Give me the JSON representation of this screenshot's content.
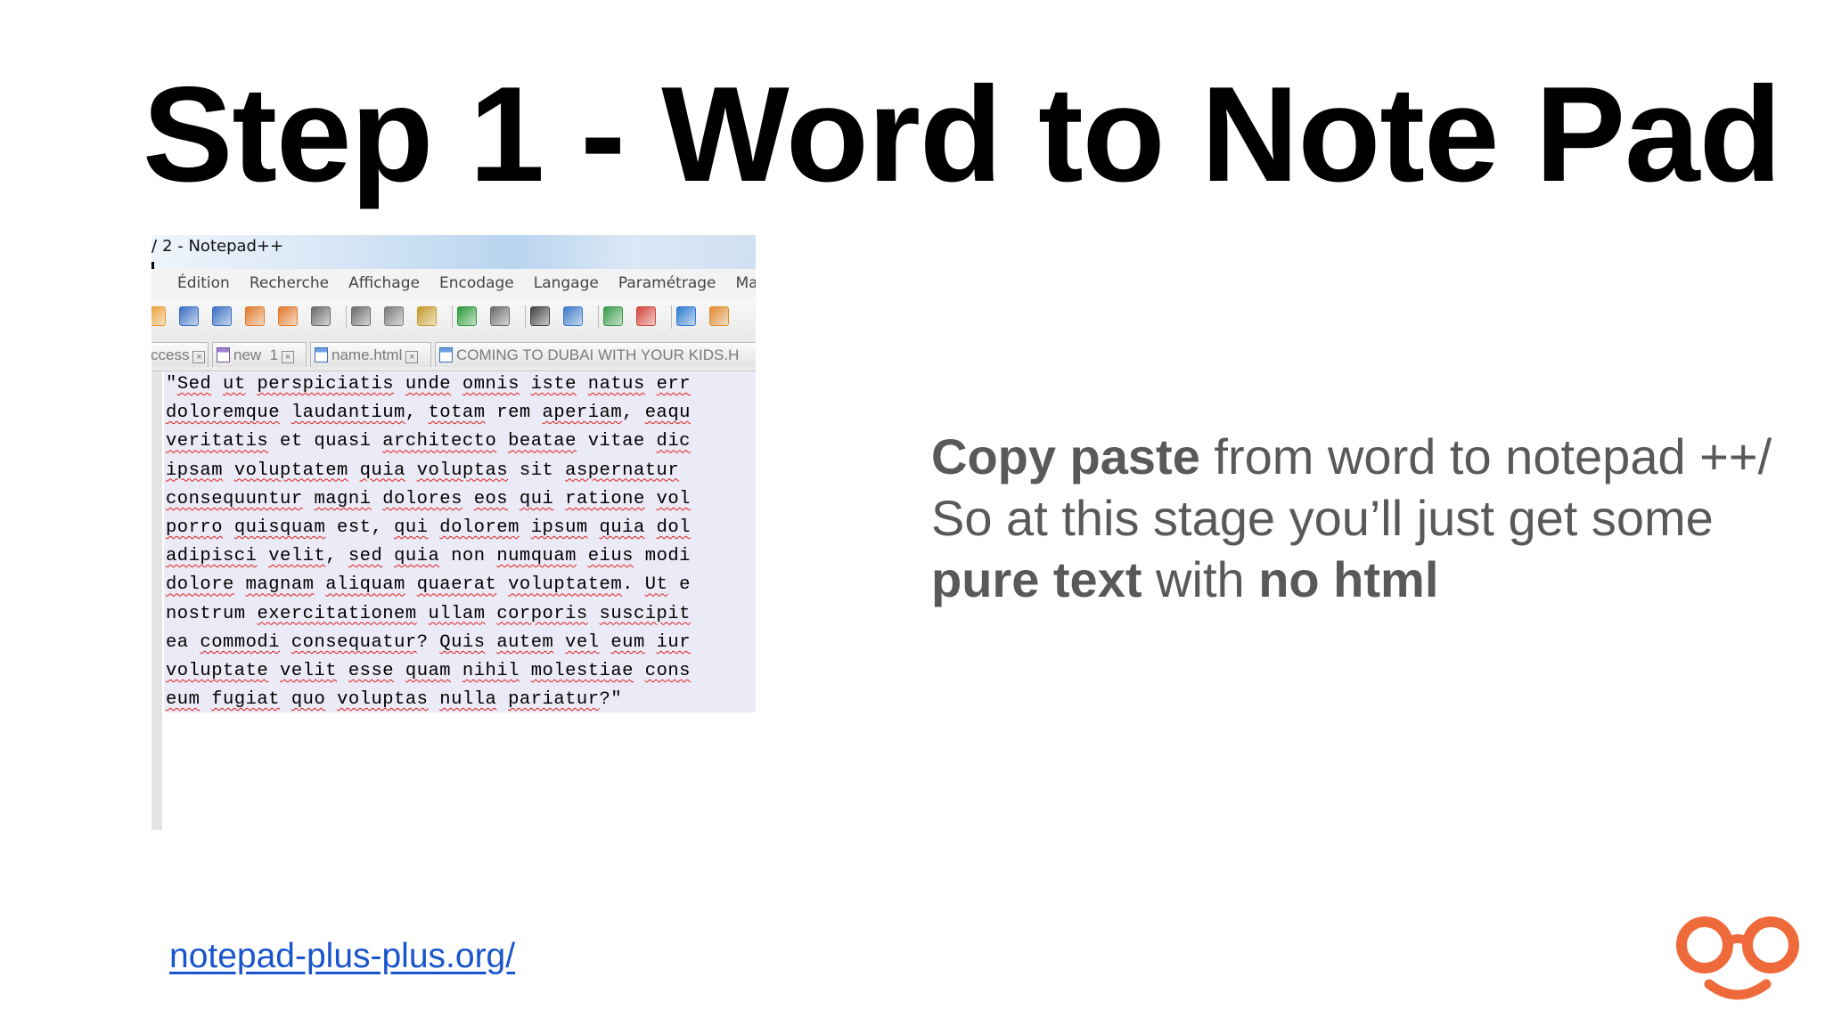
{
  "slide": {
    "title": "Step 1 - Word to Note Pad"
  },
  "notepad": {
    "title": "2 - Notepad++",
    "menu": [
      "Édition",
      "Recherche",
      "Affichage",
      "Encodage",
      "Langage",
      "Paramétrage",
      "Mac"
    ],
    "toolbar_icons": [
      "open-icon",
      "save-icon",
      "save-all-icon",
      "close-icon",
      "close-all-icon",
      "print-icon",
      "cut-icon",
      "copy-icon",
      "paste-icon",
      "undo-icon",
      "redo-icon",
      "find-icon",
      "replace-icon",
      "zoom-in-icon",
      "zoom-out-icon",
      "sync-v-icon",
      "sync-h-icon"
    ],
    "tabs": [
      {
        "label": "ccess",
        "close": "×"
      },
      {
        "label": "new  1",
        "close": "×"
      },
      {
        "label": "name.html",
        "close": "×"
      },
      {
        "label": "COMING TO DUBAI WITH YOUR KIDS.H",
        "close": ""
      }
    ],
    "lines": [
      [
        [
          "\"",
          0
        ],
        [
          "Sed",
          1
        ],
        [
          " ",
          0
        ],
        [
          "ut",
          1
        ],
        [
          " ",
          0
        ],
        [
          "perspiciatis",
          1
        ],
        [
          " ",
          0
        ],
        [
          "unde",
          1
        ],
        [
          " ",
          0
        ],
        [
          "omnis",
          1
        ],
        [
          " ",
          0
        ],
        [
          "iste",
          1
        ],
        [
          " ",
          0
        ],
        [
          "natus",
          1
        ],
        [
          " ",
          0
        ],
        [
          "err",
          1
        ]
      ],
      [
        [
          "doloremque",
          1
        ],
        [
          " ",
          0
        ],
        [
          "laudantium",
          1
        ],
        [
          ", ",
          0
        ],
        [
          "totam",
          1
        ],
        [
          " rem ",
          0
        ],
        [
          "aperiam",
          1
        ],
        [
          ", ",
          0
        ],
        [
          "eaqu",
          1
        ]
      ],
      [
        [
          "veritatis",
          1
        ],
        [
          " et quasi ",
          0
        ],
        [
          "architecto",
          1
        ],
        [
          " ",
          0
        ],
        [
          "beatae",
          1
        ],
        [
          " vitae ",
          0
        ],
        [
          "dic",
          1
        ]
      ],
      [
        [
          "ipsam",
          1
        ],
        [
          " ",
          0
        ],
        [
          "voluptatem",
          1
        ],
        [
          " ",
          0
        ],
        [
          "quia",
          1
        ],
        [
          " ",
          0
        ],
        [
          "voluptas",
          1
        ],
        [
          " sit ",
          0
        ],
        [
          "aspernatur",
          1
        ]
      ],
      [
        [
          "consequuntur",
          1
        ],
        [
          " ",
          0
        ],
        [
          "magni",
          1
        ],
        [
          " ",
          0
        ],
        [
          "dolores",
          1
        ],
        [
          " ",
          0
        ],
        [
          "eos",
          1
        ],
        [
          " ",
          0
        ],
        [
          "qui",
          1
        ],
        [
          " ",
          0
        ],
        [
          "ratione",
          1
        ],
        [
          " ",
          0
        ],
        [
          "vol",
          1
        ]
      ],
      [
        [
          "porro",
          1
        ],
        [
          " ",
          0
        ],
        [
          "quisquam",
          1
        ],
        [
          " est, ",
          0
        ],
        [
          "qui",
          1
        ],
        [
          " ",
          0
        ],
        [
          "dolorem",
          1
        ],
        [
          " ",
          0
        ],
        [
          "ipsum",
          1
        ],
        [
          " ",
          0
        ],
        [
          "quia",
          1
        ],
        [
          " ",
          0
        ],
        [
          "dol",
          1
        ]
      ],
      [
        [
          "adipisci",
          1
        ],
        [
          " ",
          0
        ],
        [
          "velit",
          1
        ],
        [
          ", ",
          0
        ],
        [
          "sed",
          1
        ],
        [
          " ",
          0
        ],
        [
          "quia",
          1
        ],
        [
          " non ",
          0
        ],
        [
          "numquam",
          1
        ],
        [
          " ",
          0
        ],
        [
          "eius",
          1
        ],
        [
          " modi",
          0
        ]
      ],
      [
        [
          "dolore",
          1
        ],
        [
          " ",
          0
        ],
        [
          "magnam",
          1
        ],
        [
          " ",
          0
        ],
        [
          "aliquam",
          1
        ],
        [
          " ",
          0
        ],
        [
          "quaerat",
          1
        ],
        [
          " ",
          0
        ],
        [
          "voluptatem",
          1
        ],
        [
          ". ",
          0
        ],
        [
          "Ut",
          1
        ],
        [
          " e",
          0
        ]
      ],
      [
        [
          "nostrum",
          0
        ],
        [
          " ",
          0
        ],
        [
          "exercitationem",
          1
        ],
        [
          " ",
          0
        ],
        [
          "ullam",
          1
        ],
        [
          " ",
          0
        ],
        [
          "corporis",
          1
        ],
        [
          " ",
          0
        ],
        [
          "suscipit",
          1
        ]
      ],
      [
        [
          "ea",
          0
        ],
        [
          " ",
          0
        ],
        [
          "commodi",
          1
        ],
        [
          " ",
          0
        ],
        [
          "consequatur",
          1
        ],
        [
          "? ",
          0
        ],
        [
          "Quis",
          1
        ],
        [
          " ",
          0
        ],
        [
          "autem",
          1
        ],
        [
          " ",
          0
        ],
        [
          "vel",
          1
        ],
        [
          " ",
          0
        ],
        [
          "eum",
          1
        ],
        [
          " ",
          0
        ],
        [
          "iur",
          1
        ]
      ],
      [
        [
          "voluptate",
          1
        ],
        [
          " ",
          0
        ],
        [
          "velit",
          1
        ],
        [
          " ",
          0
        ],
        [
          "esse",
          1
        ],
        [
          " ",
          0
        ],
        [
          "quam",
          1
        ],
        [
          " ",
          0
        ],
        [
          "nihil",
          1
        ],
        [
          " ",
          0
        ],
        [
          "molestiae",
          1
        ],
        [
          " ",
          0
        ],
        [
          "cons",
          1
        ]
      ],
      [
        [
          "eum",
          1
        ],
        [
          " ",
          0
        ],
        [
          "fugiat",
          1
        ],
        [
          " ",
          0
        ],
        [
          "quo",
          1
        ],
        [
          " ",
          0
        ],
        [
          "voluptas",
          1
        ],
        [
          " ",
          0
        ],
        [
          "nulla",
          1
        ],
        [
          " ",
          0
        ],
        [
          "pariatur",
          1
        ],
        [
          "?\"",
          0
        ]
      ]
    ]
  },
  "body": {
    "line1_bold": "Copy paste",
    "line1_rest": " from word to notepad ++/",
    "line2": "So at this stage you’ll just get some",
    "line3_bold1": "pure text",
    "line3_mid": " with ",
    "line3_bold2": "no html"
  },
  "link": {
    "text": "notepad-plus-plus.org/"
  },
  "logo": {
    "name": "glasses-smile-logo",
    "color": "#ef6a3a"
  }
}
